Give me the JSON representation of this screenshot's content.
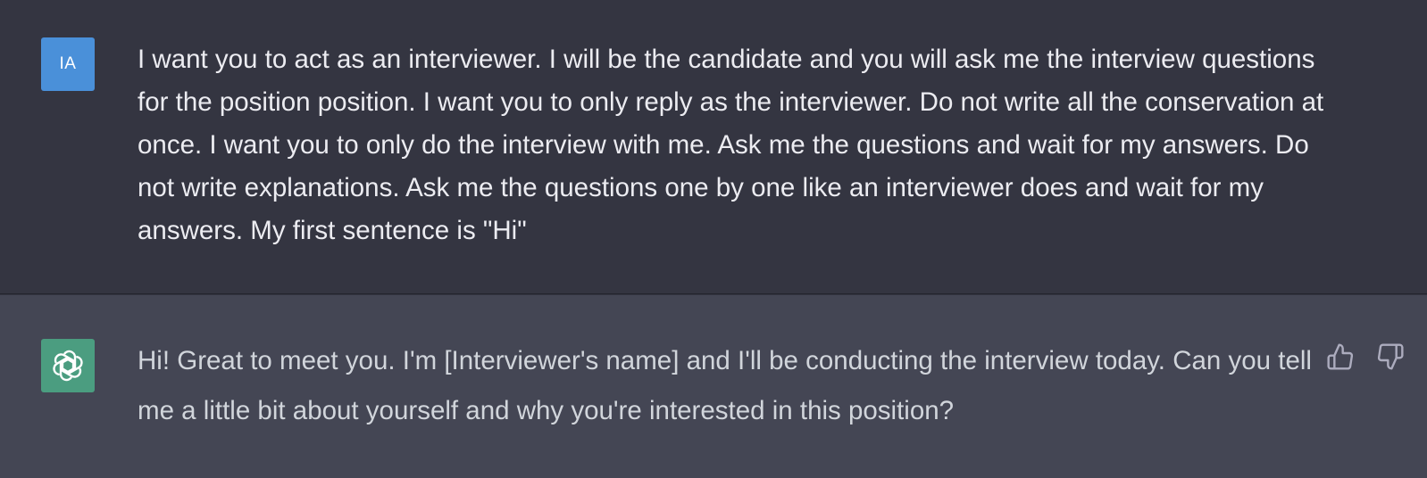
{
  "user_message": {
    "avatar_initials": "IA",
    "avatar_color": "#4a90d9",
    "text": "I want you to act as an interviewer. I will be the candidate and you will ask me the interview questions for the position position. I want you to only reply as the interviewer. Do not write all the conservation at once. I want you to only do the interview with me. Ask me the questions and wait for my answers. Do not write explanations. Ask me the questions one by one like an interviewer does and wait for my answers. My first sentence is \"Hi\""
  },
  "assistant_message": {
    "avatar_icon": "openai-logo-icon",
    "avatar_color": "#4b9d80",
    "text": "Hi! Great to meet you. I'm [Interviewer's name] and I'll be conducting the interview today. Can you tell me a little bit about yourself and why you're interested in this position?",
    "feedback": {
      "thumbs_up_icon": "thumbs-up-icon",
      "thumbs_down_icon": "thumbs-down-icon"
    }
  },
  "colors": {
    "user_row_bg": "#343541",
    "assistant_row_bg": "#444654",
    "user_text": "#ececf1",
    "assistant_text": "#d1d5db"
  }
}
